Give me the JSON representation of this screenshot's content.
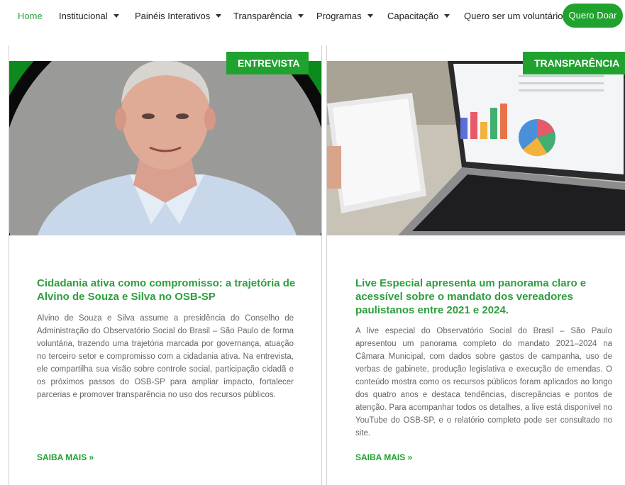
{
  "nav": {
    "items": [
      {
        "label": "Home",
        "active": true,
        "dropdown": false
      },
      {
        "label": "Institucional",
        "active": false,
        "dropdown": true
      },
      {
        "label": "Painéis Interativos",
        "active": false,
        "dropdown": true
      },
      {
        "label": "Transparência",
        "active": false,
        "dropdown": true
      },
      {
        "label": "Programas",
        "active": false,
        "dropdown": true
      },
      {
        "label": "Capacitação",
        "active": false,
        "dropdown": true
      },
      {
        "label": "Quero ser um voluntário",
        "active": false,
        "dropdown": false
      }
    ],
    "donate_label": "Quero Doar"
  },
  "colors": {
    "accent": "#1fa32e",
    "title_green": "#2e9e3e"
  },
  "cards": [
    {
      "badge": "ENTREVISTA",
      "image": "portrait-photo",
      "title": "Cidadania ativa como compromisso: a trajetória de Alvino de Souza e Silva no OSB-SP",
      "text": "Alvino de Souza e Silva assume a presidência do Conselho de Administração do Observatório Social do Brasil – São Paulo de forma voluntária, trazendo uma trajetória marcada por governança, atuação no terceiro setor e compromisso com a cidadania ativa. Na entrevista, ele compartilha sua visão sobre controle social, participação cidadã e os próximos passos do OSB-SP para ampliar impacto, fortalecer parcerias e promover transparência no uso dos recursos públicos.",
      "read_more": "SAIBA MAIS »"
    },
    {
      "badge": "TRANSPARÊNCIA",
      "image": "laptop-charts-photo",
      "title": "Live Especial apresenta um panorama claro e acessível sobre o mandato dos vereadores paulistanos entre 2021 e 2024.",
      "text": "A live especial do Observatório Social do Brasil – São Paulo apresentou um panorama completo do mandato 2021–2024 na Câmara Municipal, com dados sobre gastos de campanha, uso de verbas de gabinete, produção legislativa e execução de emendas. O conteúdo mostra como os recursos públicos foram aplicados ao longo dos quatro anos e destaca tendências, discrepâncias e pontos de atenção. Para acompanhar todos os detalhes, a live está disponível no YouTube do OSB-SP, e o relatório completo pode ser consultado no site.",
      "read_more": "SAIBA MAIS »"
    }
  ]
}
